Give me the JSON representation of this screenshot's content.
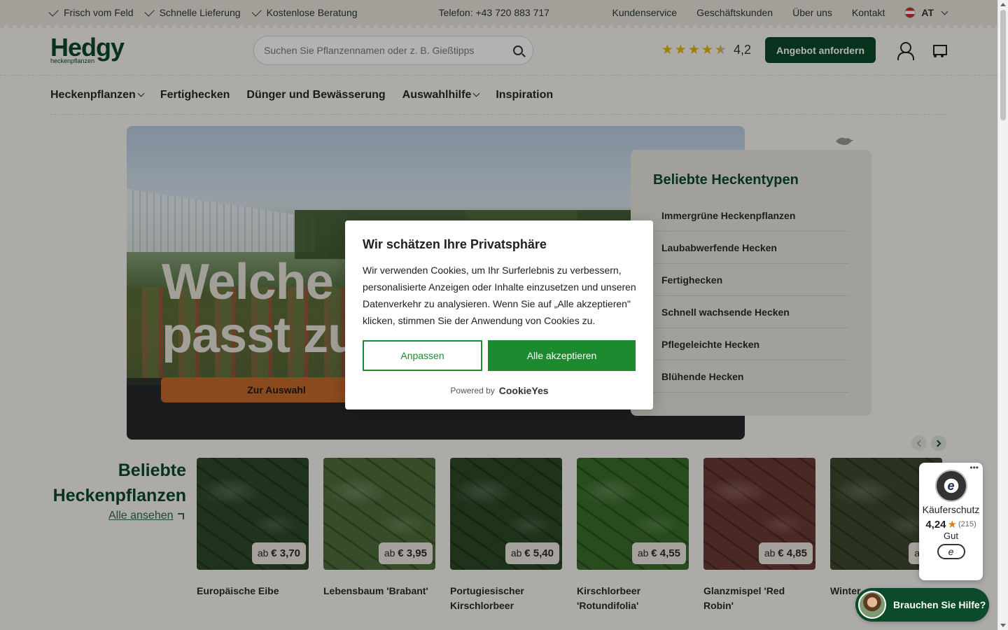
{
  "topbar": {
    "usps": [
      "Frisch vom Feld",
      "Schnelle Lieferung",
      "Kostenlose Beratung"
    ],
    "phone": "Telefon: +43 720 883 717",
    "links": [
      "Kundenservice",
      "Geschäftskunden",
      "Über uns",
      "Kontakt"
    ],
    "language": "AT"
  },
  "header": {
    "logo_main": "Hedgy",
    "logo_sub": "heckenpflanzen",
    "search_placeholder": "Suchen Sie Pflanzennamen oder z. B. Gießtipps",
    "rating_value": "4,2",
    "rating_stars": 4.2,
    "offer_button": "Angebot anfordern"
  },
  "nav": {
    "items": [
      {
        "label": "Heckenpflanzen",
        "dropdown": true
      },
      {
        "label": "Fertighecken",
        "dropdown": false
      },
      {
        "label": "Dünger und Bewässerung",
        "dropdown": false
      },
      {
        "label": "Auswahlhilfe",
        "dropdown": true
      },
      {
        "label": "Inspiration",
        "dropdown": false
      }
    ]
  },
  "hero": {
    "title_line1": "Welche",
    "title_line2": "passt zu",
    "button": "Zur Auswahl"
  },
  "hedge_types": {
    "title": "Beliebte Heckentypen",
    "items": [
      "Immergrüne Heckenpflanzen",
      "Laubabwerfende Hecken",
      "Fertighecken",
      "Schnell wachsende Hecken",
      "Pflegeleichte Hecken",
      "Blühende Hecken"
    ]
  },
  "popular": {
    "title_line1": "Beliebte",
    "title_line2": "Heckenpflanzen",
    "see_all": "Alle ansehen",
    "products": [
      {
        "name": "Europäische Eibe",
        "price_prefix": "ab",
        "price": "€ 3,70",
        "color": "#2f4a2a"
      },
      {
        "name": "Lebensbaum 'Brabant'",
        "price_prefix": "ab",
        "price": "€ 3,95",
        "color": "#4f6e3a"
      },
      {
        "name": "Portugiesischer Kirschlorbeer",
        "price_prefix": "ab",
        "price": "€ 5,40",
        "color": "#2c4a26"
      },
      {
        "name": "Kirschlorbeer 'Rotundifolia'",
        "price_prefix": "ab",
        "price": "€ 4,55",
        "color": "#3b6e2c"
      },
      {
        "name": "Glanzmispel 'Red Robin'",
        "price_prefix": "ab",
        "price": "€ 4,85",
        "color": "#6b3a34"
      },
      {
        "name": "Winter",
        "price_prefix": "ab",
        "price": "€",
        "color": "#3e4a2e"
      }
    ]
  },
  "cookie": {
    "title": "Wir schätzen Ihre Privatsphäre",
    "text": "Wir verwenden Cookies, um Ihr Surferlebnis zu verbessern, personalisierte Anzeigen oder Inhalte einzusetzen und unseren Datenverkehr zu analysieren. Wenn Sie auf „Alle akzeptieren\" klicken, stimmen Sie der Anwendung von Cookies zu.",
    "customize": "Anpassen",
    "accept_all": "Alle akzeptieren",
    "powered_by": "Powered by",
    "brand": "CookieYes"
  },
  "trusted_shops": {
    "dots": "•••",
    "seal_letter": "e",
    "label": "Käuferschutz",
    "score": "4,24",
    "count": "(215)",
    "grade": "Gut"
  },
  "help": {
    "label": "Brauchen Sie Hilfe?"
  }
}
